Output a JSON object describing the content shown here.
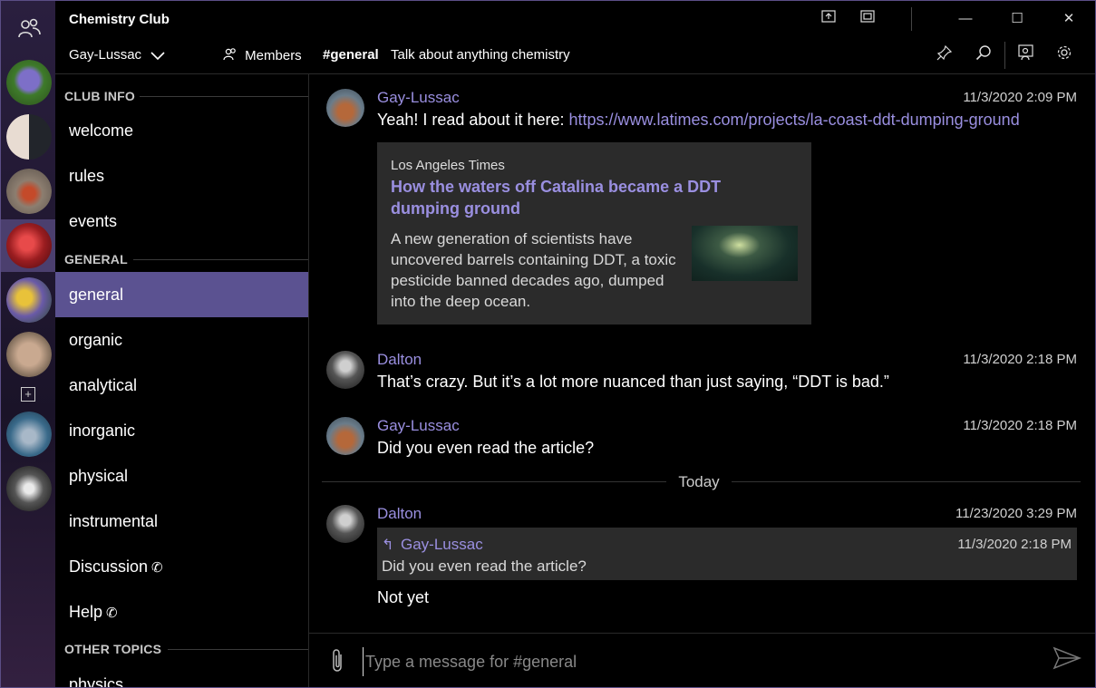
{
  "window": {
    "title": "Chemistry Club",
    "controls": {
      "minimize": "—",
      "maximize": "☐",
      "close": "✕"
    }
  },
  "header": {
    "user": "Gay-Lussac",
    "members_label": "Members",
    "channel": "#general",
    "channel_description": "Talk about anything chemistry"
  },
  "sidebar": {
    "sections": [
      {
        "title": "CLUB INFO"
      },
      {
        "title": "GENERAL"
      },
      {
        "title": "OTHER TOPICS"
      }
    ],
    "channels": [
      {
        "label": "welcome"
      },
      {
        "label": "rules"
      },
      {
        "label": "events"
      },
      {
        "label": "general"
      },
      {
        "label": "organic"
      },
      {
        "label": "analytical"
      },
      {
        "label": "inorganic"
      },
      {
        "label": "physical"
      },
      {
        "label": "instrumental"
      },
      {
        "label": "Discussion"
      },
      {
        "label": "Help"
      },
      {
        "label": "physics"
      }
    ],
    "active_channel": "general"
  },
  "messages": [
    {
      "author": "Gay-Lussac",
      "timestamp": "11/3/2020 2:09 PM",
      "text": "Yeah! I read about it here: ",
      "link": "https://www.latimes.com/projects/la-coast-ddt-dumping-ground",
      "preview": {
        "source": "Los Angeles Times",
        "title": "How the waters off Catalina became a DDT dumping ground",
        "description": "A new generation of scientists have uncovered barrels containing DDT, a toxic pesticide banned decades ago, dumped into the deep ocean."
      }
    },
    {
      "author": "Dalton",
      "timestamp": "11/3/2020 2:18 PM",
      "text": "That’s crazy. But it’s a lot more nuanced than just saying, “DDT is bad.”"
    },
    {
      "author": "Gay-Lussac",
      "timestamp": "11/3/2020 2:18 PM",
      "text": "Did you even read the article?"
    },
    {
      "author": "Dalton",
      "timestamp": "11/23/2020 3:29 PM",
      "reply_to": {
        "author": "Gay-Lussac",
        "timestamp": "11/3/2020 2:18 PM",
        "text": "Did you even read the article?"
      },
      "text": "Not yet"
    }
  ],
  "divider_label": "Today",
  "compose": {
    "placeholder": "Type a message for #general"
  },
  "colors": {
    "accent": "#9a8fe0",
    "active_channel_bg": "#5b5291",
    "background": "#000000",
    "card_bg": "#2b2b2b"
  },
  "icons": {
    "members": "people-icon",
    "pin": "pin-icon",
    "search": "search-icon",
    "members_panel": "members-panel-icon",
    "settings": "gear-icon",
    "attach": "paperclip-icon",
    "send": "send-icon"
  }
}
